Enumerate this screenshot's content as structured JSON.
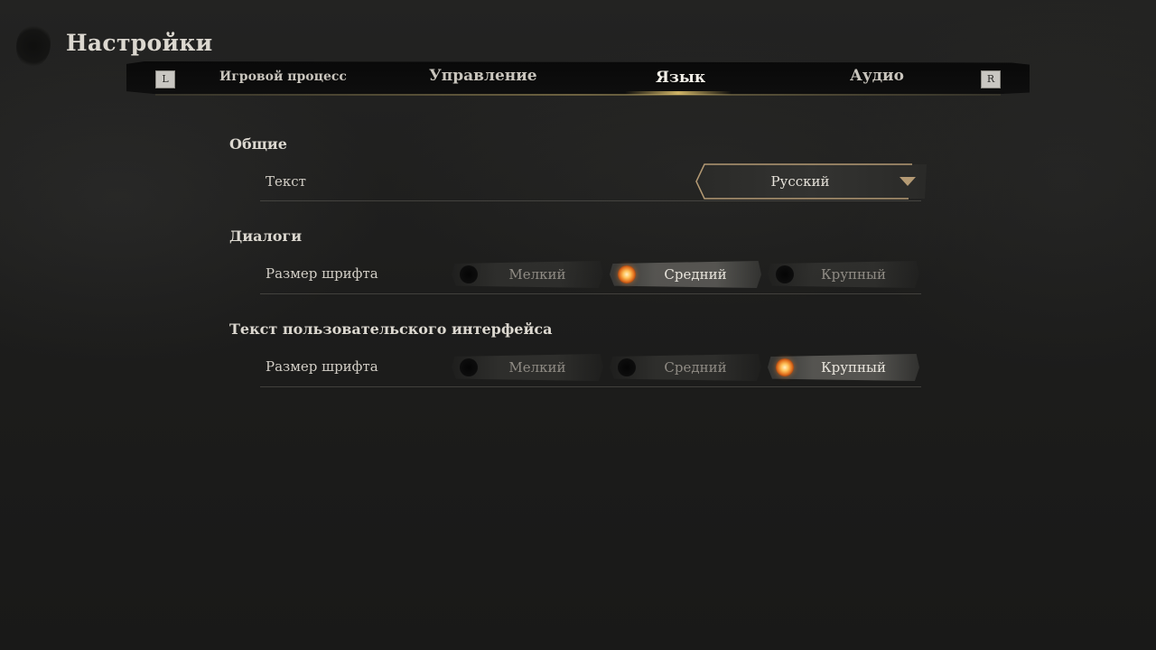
{
  "header": {
    "title": "Настройки"
  },
  "tabs": {
    "left_key": "L",
    "right_key": "R",
    "items": [
      {
        "label": "Игровой процесс",
        "active": false
      },
      {
        "label": "Управление",
        "active": false
      },
      {
        "label": "Язык",
        "active": true
      },
      {
        "label": "Аудио",
        "active": false
      }
    ]
  },
  "sections": [
    {
      "title": "Общие",
      "rows": [
        {
          "label": "Текст",
          "control": "dropdown",
          "value": "Русский"
        }
      ]
    },
    {
      "title": "Диалоги",
      "rows": [
        {
          "label": "Размер шрифта",
          "control": "radio",
          "options": [
            "Мелкий",
            "Средний",
            "Крупный"
          ],
          "selected": "Средний"
        }
      ]
    },
    {
      "title": "Текст пользовательского интерфейса",
      "rows": [
        {
          "label": "Размер шрифта",
          "control": "radio",
          "options": [
            "Мелкий",
            "Средний",
            "Крупный"
          ],
          "selected": "Крупный"
        }
      ]
    }
  ],
  "icons": {
    "radio_selected": "radio-selected-icon",
    "radio_unselected": "radio-unselected-icon",
    "dropdown": "dropdown-arrow-icon"
  },
  "colors": {
    "accent": "#e47420",
    "gold": "#b49a74",
    "background": "#1c1c1b"
  }
}
